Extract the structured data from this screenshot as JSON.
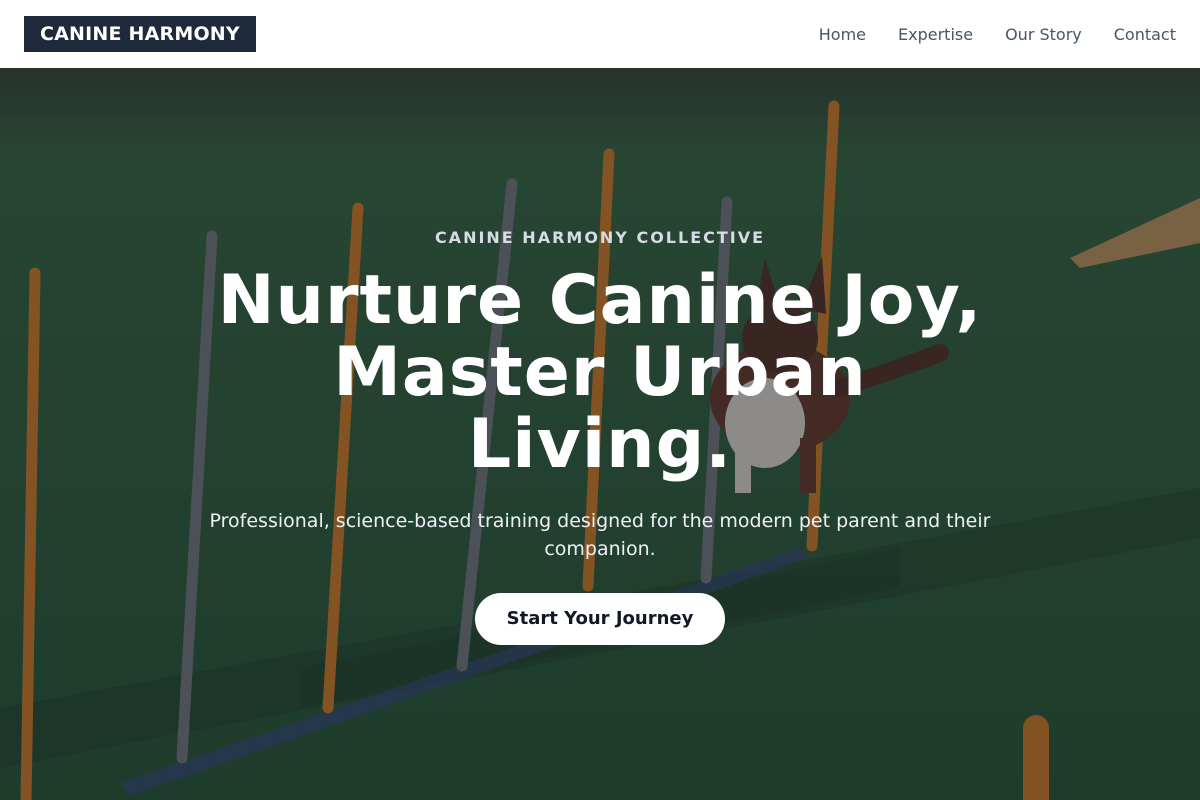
{
  "header": {
    "logo_text": "CANINE HARMONY",
    "nav": [
      {
        "label": "Home"
      },
      {
        "label": "Expertise"
      },
      {
        "label": "Our Story"
      },
      {
        "label": "Contact"
      }
    ]
  },
  "hero": {
    "eyebrow": "CANINE HARMONY COLLECTIVE",
    "headline": "Nurture Canine Joy, Master Urban Living.",
    "subhead": "Professional, science-based training designed for the modern pet parent and their companion.",
    "cta_label": "Start Your Journey"
  },
  "colors": {
    "logo_bg": "#1e293b",
    "nav_text": "#475569",
    "turf": "#2f5a3c",
    "pole_orange": "#d9822b",
    "pole_gray": "#7a7f86"
  }
}
